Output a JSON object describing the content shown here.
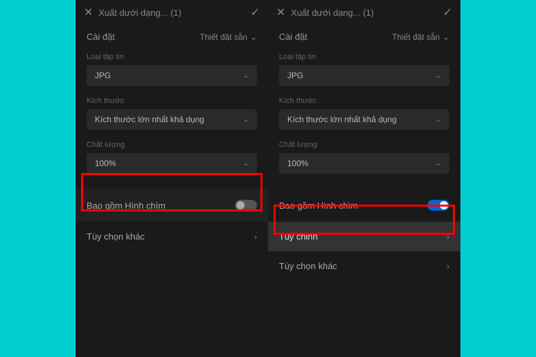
{
  "left": {
    "title": "Xuất dưới dạng... (1)",
    "settingsLabel": "Cài đặt",
    "presetLabel": "Thiết đặt sẵn",
    "fileTypeLabel": "Loại tập tin",
    "fileTypeValue": "JPG",
    "sizeLabel": "Kích thước",
    "sizeValue": "Kích thước lớn nhất khả dụng",
    "qualityLabel": "Chất lượng",
    "qualityValue": "100%",
    "watermarkLabel": "Bao gồm Hình chìm",
    "otherOptionsLabel": "Tùy chọn khác"
  },
  "right": {
    "title": "Xuất dưới dạng... (1)",
    "settingsLabel": "Cài đặt",
    "presetLabel": "Thiết đặt sẵn",
    "fileTypeLabel": "Loại tập tin",
    "fileTypeValue": "JPG",
    "sizeLabel": "Kích thước",
    "sizeValue": "Kích thước lớn nhất khả dụng",
    "qualityLabel": "Chất lượng",
    "qualityValue": "100%",
    "watermarkLabel": "Bao gồm Hình chìm",
    "customizeLabel": "Tùy chỉnh",
    "otherOptionsLabel": "Tùy chọn khác"
  }
}
